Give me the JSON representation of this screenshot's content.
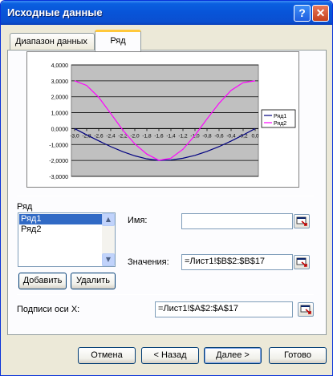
{
  "window": {
    "title": "Исходные данные",
    "help_label": "?",
    "close_label": "✕"
  },
  "tabs": [
    {
      "label": "Диапазон данных",
      "active": false
    },
    {
      "label": "Ряд",
      "active": true
    }
  ],
  "chart_data": {
    "type": "line",
    "title": "",
    "xlabel": "",
    "ylabel": "",
    "categories": [
      "-3,0",
      "-2,8",
      "-2,6",
      "-2,4",
      "-2,2",
      "-2,0",
      "-1,8",
      "-1,6",
      "-1,4",
      "-1,2",
      "-1,0",
      "-0,8",
      "-0,6",
      "-0,4",
      "-0,2",
      "0,0"
    ],
    "x": [
      -3.0,
      -2.8,
      -2.6,
      -2.4,
      -2.2,
      -2.0,
      -1.8,
      -1.6,
      -1.4,
      -1.2,
      -1.0,
      -0.8,
      -0.6,
      -0.4,
      -0.2,
      0.0
    ],
    "ylim": [
      -3,
      4
    ],
    "yticks": [
      "4,0000",
      "3,0000",
      "2,0000",
      "1,0000",
      "0,0000",
      "-1,0000",
      "-2,0000",
      "-3,0000"
    ],
    "series": [
      {
        "name": "Ряд1",
        "color": "#000080",
        "values": [
          0.0,
          -0.39,
          -0.77,
          -1.13,
          -1.45,
          -1.71,
          -1.9,
          -2.0,
          -1.97,
          -1.86,
          -1.68,
          -1.43,
          -1.13,
          -0.78,
          -0.4,
          0.0
        ]
      },
      {
        "name": "Ряд2",
        "color": "#ff00ff",
        "values": [
          3.0,
          2.71,
          1.97,
          0.95,
          -0.09,
          -0.96,
          -1.6,
          -1.99,
          -1.86,
          -1.3,
          -0.42,
          0.61,
          1.59,
          2.4,
          2.89,
          3.0
        ]
      }
    ],
    "plot_background": "#c0c0c0",
    "grid": true,
    "legend": "right"
  },
  "series_group": {
    "label": "Ряд",
    "items": [
      {
        "label": "Ряд1",
        "selected": true
      },
      {
        "label": "Ряд2",
        "selected": false
      }
    ],
    "add_label": "Добавить",
    "remove_label": "Удалить"
  },
  "fields": {
    "name_label": "Имя:",
    "name_value": "",
    "values_label": "Значения:",
    "values_value": "=Лист1!$B$2:$B$17",
    "xlabels_label": "Подписи оси X:",
    "xlabels_value": "=Лист1!$A$2:$A$17"
  },
  "footer": {
    "cancel_label": "Отмена",
    "back_label": "< Назад",
    "next_label": "Далее >",
    "finish_label": "Готово"
  },
  "colors": {
    "titlebar": "#0854d8",
    "selection": "#316ac5",
    "dialog_bg": "#ece9d8"
  }
}
